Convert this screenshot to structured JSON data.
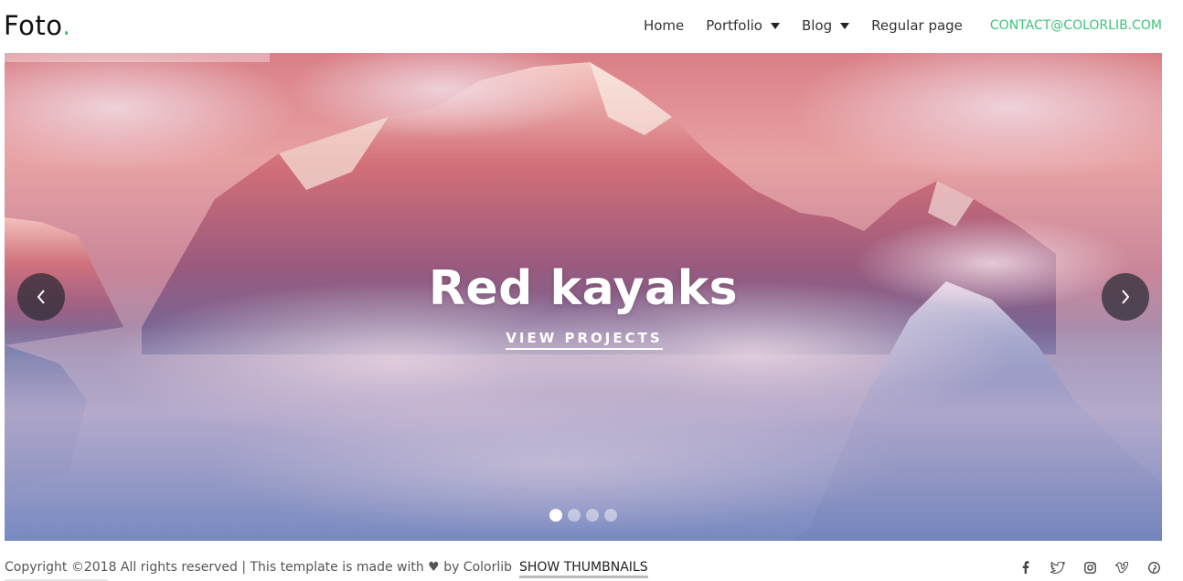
{
  "brand": {
    "name": "Foto",
    "dot": "."
  },
  "nav": {
    "items": [
      {
        "label": "Home",
        "dropdown": false
      },
      {
        "label": "Portfolio",
        "dropdown": true
      },
      {
        "label": "Blog",
        "dropdown": true
      },
      {
        "label": "Regular page",
        "dropdown": false
      }
    ],
    "contact": "CONTACT@COLORLIB.COM"
  },
  "hero": {
    "title": "Red kayaks",
    "link": "VIEW PROJECTS",
    "prev_icon": "chevron-left-icon",
    "next_icon": "chevron-right-icon",
    "slides_total": 4,
    "active_slide": 1
  },
  "footer": {
    "copyright_prefix": "Copyright ©2018 All rights reserved | This template is made with",
    "heart": "♥",
    "copyright_suffix": "by Colorlib",
    "show_thumbnails": "SHOW THUMBNAILS",
    "socials": [
      "facebook-icon",
      "twitter-icon",
      "instagram-icon",
      "vimeo-icon",
      "pinterest-icon"
    ]
  },
  "colors": {
    "accent": "#3cc57a",
    "text": "#333333"
  }
}
